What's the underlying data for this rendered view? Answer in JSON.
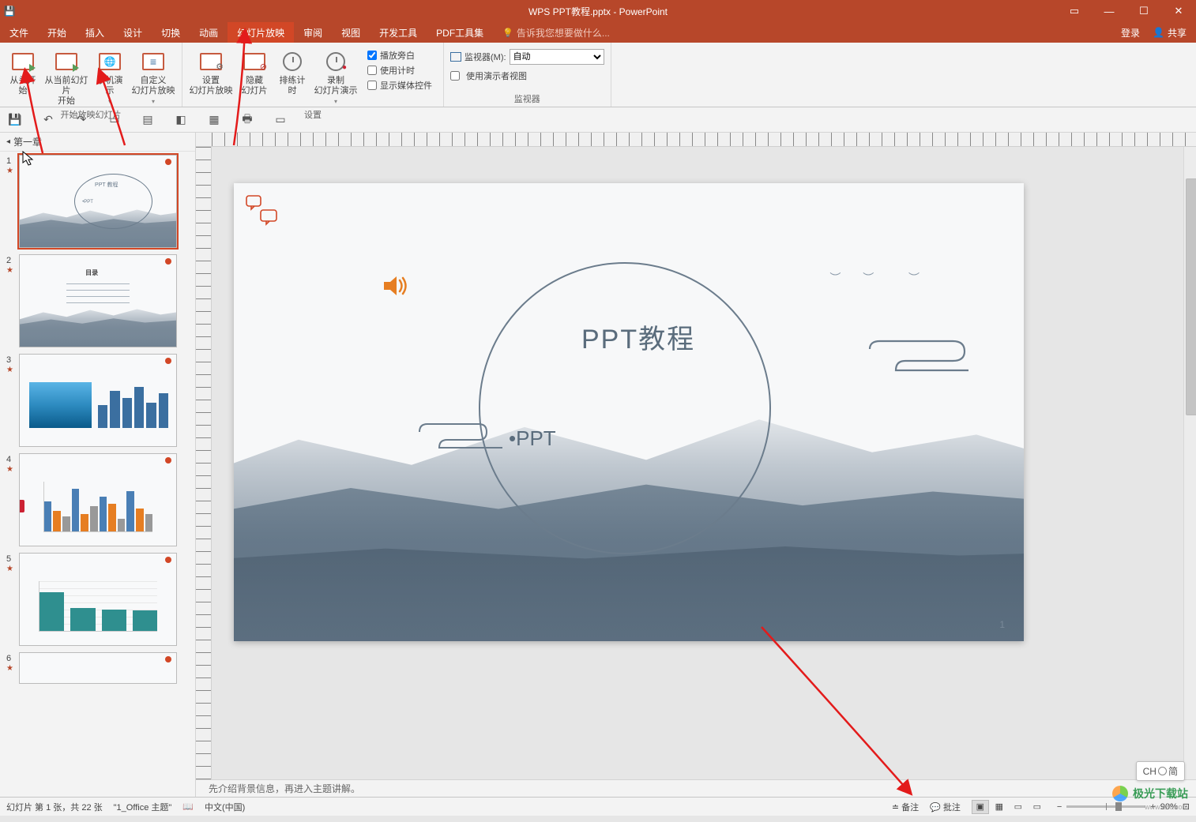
{
  "titlebar": {
    "title": "WPS PPT教程.pptx - PowerPoint"
  },
  "tabs": {
    "file": "文件",
    "home": "开始",
    "insert": "插入",
    "design": "设计",
    "transition": "切换",
    "animation": "动画",
    "slideshow": "幻灯片放映",
    "review": "审阅",
    "view": "视图",
    "dev": "开发工具",
    "pdf": "PDF工具集",
    "tellme": "告诉我您想要做什么...",
    "login": "登录",
    "share": "共享"
  },
  "ribbon": {
    "from_start": "从头开始",
    "from_current": "从当前幻灯片\n开始",
    "online": "联机演示",
    "custom": "自定义\n幻灯片放映",
    "setup": "设置\n幻灯片放映",
    "hide": "隐藏\n幻灯片",
    "rehearse": "排练计时",
    "record": "录制\n幻灯片演示",
    "narration": "播放旁白",
    "timings": "使用计时",
    "media": "显示媒体控件",
    "monitor_label": "监视器(M):",
    "monitor_value": "自动",
    "presenter_view": "使用演示者视图",
    "group_start": "开始放映幻灯片",
    "group_setup": "设置",
    "group_monitor": "监视器"
  },
  "thumbs": {
    "section": "第一章",
    "slide1": {
      "title": "PPT 教程",
      "sub": "•PPT"
    },
    "slide2": {
      "title": "目录"
    }
  },
  "slide": {
    "title": "PPT教程",
    "subtitle": "•PPT",
    "page": "1"
  },
  "notes": {
    "placeholder": "先介绍背景信息，再进入主题讲解。"
  },
  "status": {
    "slide_pos": "幻灯片 第 1 张，共 22 张",
    "theme": "\"1_Office 主题\"",
    "lang": "中文(中国)",
    "notes_btn": "备注",
    "comments_btn": "批注",
    "zoom": "90%"
  },
  "ime": {
    "prefix": "CH",
    "suffix": "简"
  },
  "watermark": {
    "text": "极光下载站",
    "url": "www.xz7.com"
  }
}
